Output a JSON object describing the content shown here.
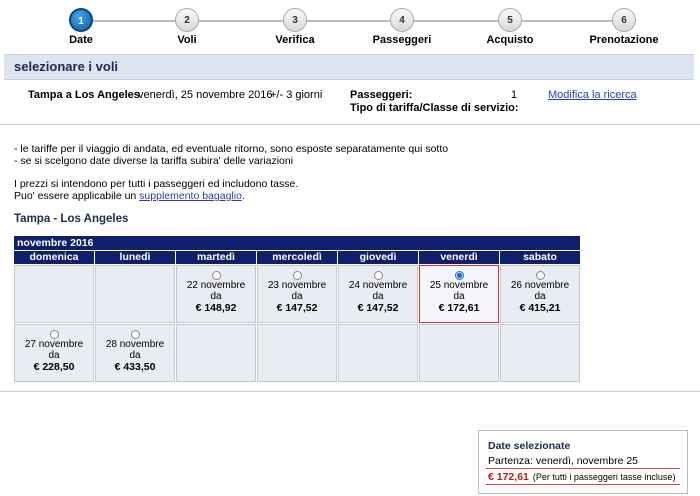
{
  "steps": [
    {
      "num": "1",
      "label": "Date"
    },
    {
      "num": "2",
      "label": "Voli"
    },
    {
      "num": "3",
      "label": "Verifica"
    },
    {
      "num": "4",
      "label": "Passeggeri"
    },
    {
      "num": "5",
      "label": "Acquisto"
    },
    {
      "num": "6",
      "label": "Prenotazione"
    }
  ],
  "section": {
    "title": "selezionare i voli"
  },
  "search": {
    "route": "Tampa a Los Angeles",
    "date": "venerdì, 25 novembre 2016",
    "flex": "+/- 3 giorni",
    "passengers_label": "Passeggeri:",
    "passengers_value": "1",
    "fare_label": "Tipo di tariffa/Classe di servizio:",
    "modify_link": "Modifica la ricerca"
  },
  "notes": {
    "line1": "- le tariffe per il viaggio di andata, ed eventuale ritorno, sono esposte separatamente qui sotto",
    "line2": "- se si scelgono date diverse la tariffa subira' delle variazioni",
    "line3": "I prezzi si intendono per tutti i passeggeri ed includono tasse.",
    "line4_pre": "Puo' essere applicabile un ",
    "line4_link": "supplemento bagaglio",
    "line4_post": "."
  },
  "calendar": {
    "title": "Tampa - Los Angeles",
    "month": "novembre 2016",
    "days": [
      "domenica",
      "lunedì",
      "martedì",
      "mercoledì",
      "giovedì",
      "venerdì",
      "sabato"
    ],
    "row1": [
      {
        "d1": "",
        "d2": "",
        "price": ""
      },
      {
        "d1": "",
        "d2": "",
        "price": ""
      },
      {
        "d1": "22 novembre",
        "d2": "da",
        "price": "€ 148,92"
      },
      {
        "d1": "23 novembre",
        "d2": "da",
        "price": "€ 147,52"
      },
      {
        "d1": "24 novembre",
        "d2": "da",
        "price": "€ 147,52"
      },
      {
        "d1": "25 novembre",
        "d2": "da",
        "price": "€ 172,61"
      },
      {
        "d1": "26 novembre",
        "d2": "da",
        "price": "€ 415,21"
      }
    ],
    "row2": [
      {
        "d1": "27 novembre",
        "d2": "da",
        "price": "€ 228,50"
      },
      {
        "d1": "28 novembre",
        "d2": "da",
        "price": "€ 433,50"
      }
    ]
  },
  "summary": {
    "title": "Date selezionate",
    "departure": "Partenza: venerdì, novembre 25",
    "price": "€ 172,61",
    "note": "(Per tutti i passeggeri tasse incluse)"
  }
}
